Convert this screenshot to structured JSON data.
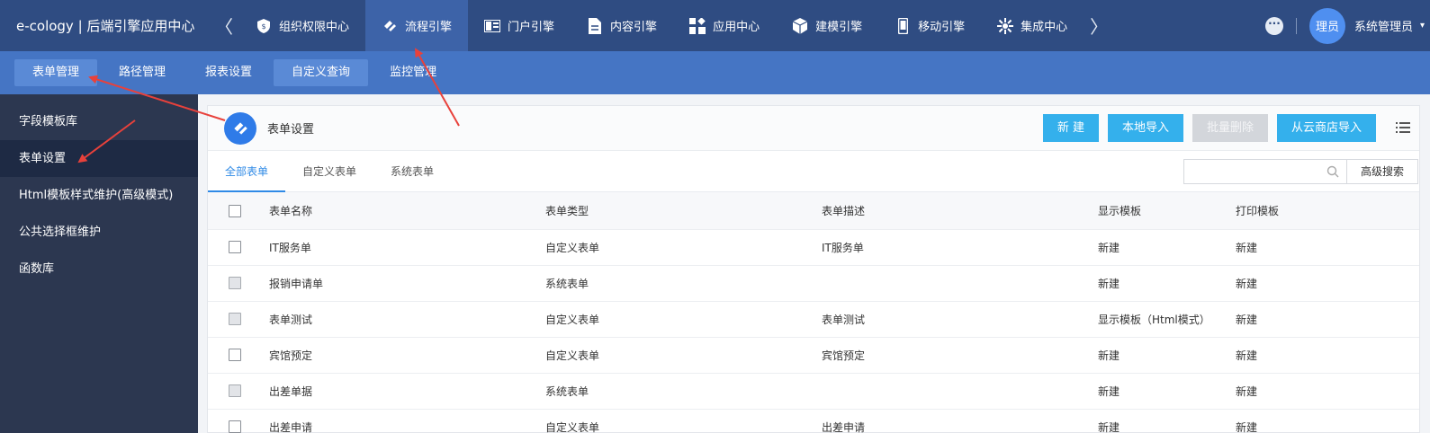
{
  "app": {
    "brand": "e-cology | 后端引擎应用中心"
  },
  "topnav": {
    "prev_arrow": "〈",
    "next_arrow": "〉",
    "items": [
      {
        "label": "组织权限中心",
        "icon": "shield-icon",
        "active": false
      },
      {
        "label": "流程引擎",
        "icon": "workflow-icon",
        "active": true
      },
      {
        "label": "门户引擎",
        "icon": "portal-icon",
        "active": false
      },
      {
        "label": "内容引擎",
        "icon": "document-icon",
        "active": false
      },
      {
        "label": "应用中心",
        "icon": "apps-icon",
        "active": false
      },
      {
        "label": "建模引擎",
        "icon": "cube-icon",
        "active": false
      },
      {
        "label": "移动引擎",
        "icon": "mobile-icon",
        "active": false
      },
      {
        "label": "集成中心",
        "icon": "integration-icon",
        "active": false
      }
    ]
  },
  "user": {
    "avatar_text": "理员",
    "name": "系统管理员"
  },
  "subnav": {
    "items": [
      {
        "label": "表单管理",
        "active": true
      },
      {
        "label": "路径管理",
        "active": false
      },
      {
        "label": "报表设置",
        "active": false
      },
      {
        "label": "自定义查询",
        "active": true
      },
      {
        "label": "监控管理",
        "active": false
      }
    ]
  },
  "sidebar": {
    "items": [
      {
        "label": "字段模板库",
        "active": false
      },
      {
        "label": "表单设置",
        "active": true
      },
      {
        "label": "Html模板样式维护(高级模式)",
        "active": false
      },
      {
        "label": "公共选择框维护",
        "active": false
      },
      {
        "label": "函数库",
        "active": false
      }
    ]
  },
  "main": {
    "title": "表单设置",
    "buttons": {
      "new": "新 建",
      "local_import": "本地导入",
      "batch_delete": "批量删除",
      "cloud_import": "从云商店导入"
    },
    "tabs": [
      {
        "label": "全部表单",
        "active": true
      },
      {
        "label": "自定义表单",
        "active": false
      },
      {
        "label": "系统表单",
        "active": false
      }
    ],
    "search": {
      "placeholder": "",
      "advanced_label": "高级搜索"
    },
    "table": {
      "columns": [
        "表单名称",
        "表单类型",
        "表单描述",
        "显示模板",
        "打印模板"
      ],
      "rows": [
        {
          "name": "IT服务单",
          "type": "自定义表单",
          "desc": "IT服务单",
          "display": "新建",
          "print": "新建",
          "cb_grey": false
        },
        {
          "name": "报销申请单",
          "type": "系统表单",
          "desc": "",
          "display": "新建",
          "print": "新建",
          "cb_grey": true
        },
        {
          "name": "表单测试",
          "type": "自定义表单",
          "desc": "表单测试",
          "display": "显示模板（Html模式）",
          "print": "新建",
          "cb_grey": true
        },
        {
          "name": "宾馆预定",
          "type": "自定义表单",
          "desc": "宾馆预定",
          "display": "新建",
          "print": "新建",
          "cb_grey": false
        },
        {
          "name": "出差单据",
          "type": "系统表单",
          "desc": "",
          "display": "新建",
          "print": "新建",
          "cb_grey": true
        },
        {
          "name": "出差申请",
          "type": "自定义表单",
          "desc": "出差申请",
          "display": "新建",
          "print": "新建",
          "cb_grey": false
        }
      ]
    }
  },
  "colors": {
    "topbar": "#2f4c82",
    "subnav": "#4575c4",
    "sidebar": "#2c3750",
    "accent": "#34b0ec",
    "annotation": "#e8413b"
  }
}
